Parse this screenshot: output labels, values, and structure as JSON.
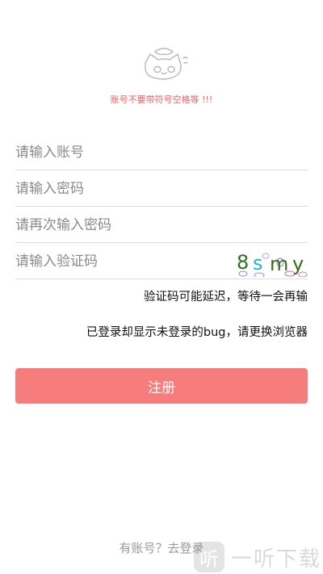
{
  "notice": "账号不要带符号空格等 !!!",
  "fields": {
    "account_placeholder": "请输入账号",
    "password_placeholder": "请输入密码",
    "password_repeat_placeholder": "请再次输入密码",
    "captcha_placeholder": "请输入验证码",
    "captcha_code": [
      "8",
      "s",
      "m",
      "y"
    ],
    "captcha_colors": [
      "#2f6f1e",
      "#20b3c4",
      "#3d6b1c",
      "#2e6d10"
    ]
  },
  "hints": {
    "captcha_delay": "验证码可能延迟，等待一会再输",
    "bug_notice": "已登录却显示未登录的bug，请更换浏览器"
  },
  "register_label": "注册",
  "login_link": "有账号？去登录",
  "watermark": {
    "icon_char": "听",
    "text": "一听下载"
  },
  "colors": {
    "accent": "#f77d7d",
    "notice": "#f06262"
  }
}
